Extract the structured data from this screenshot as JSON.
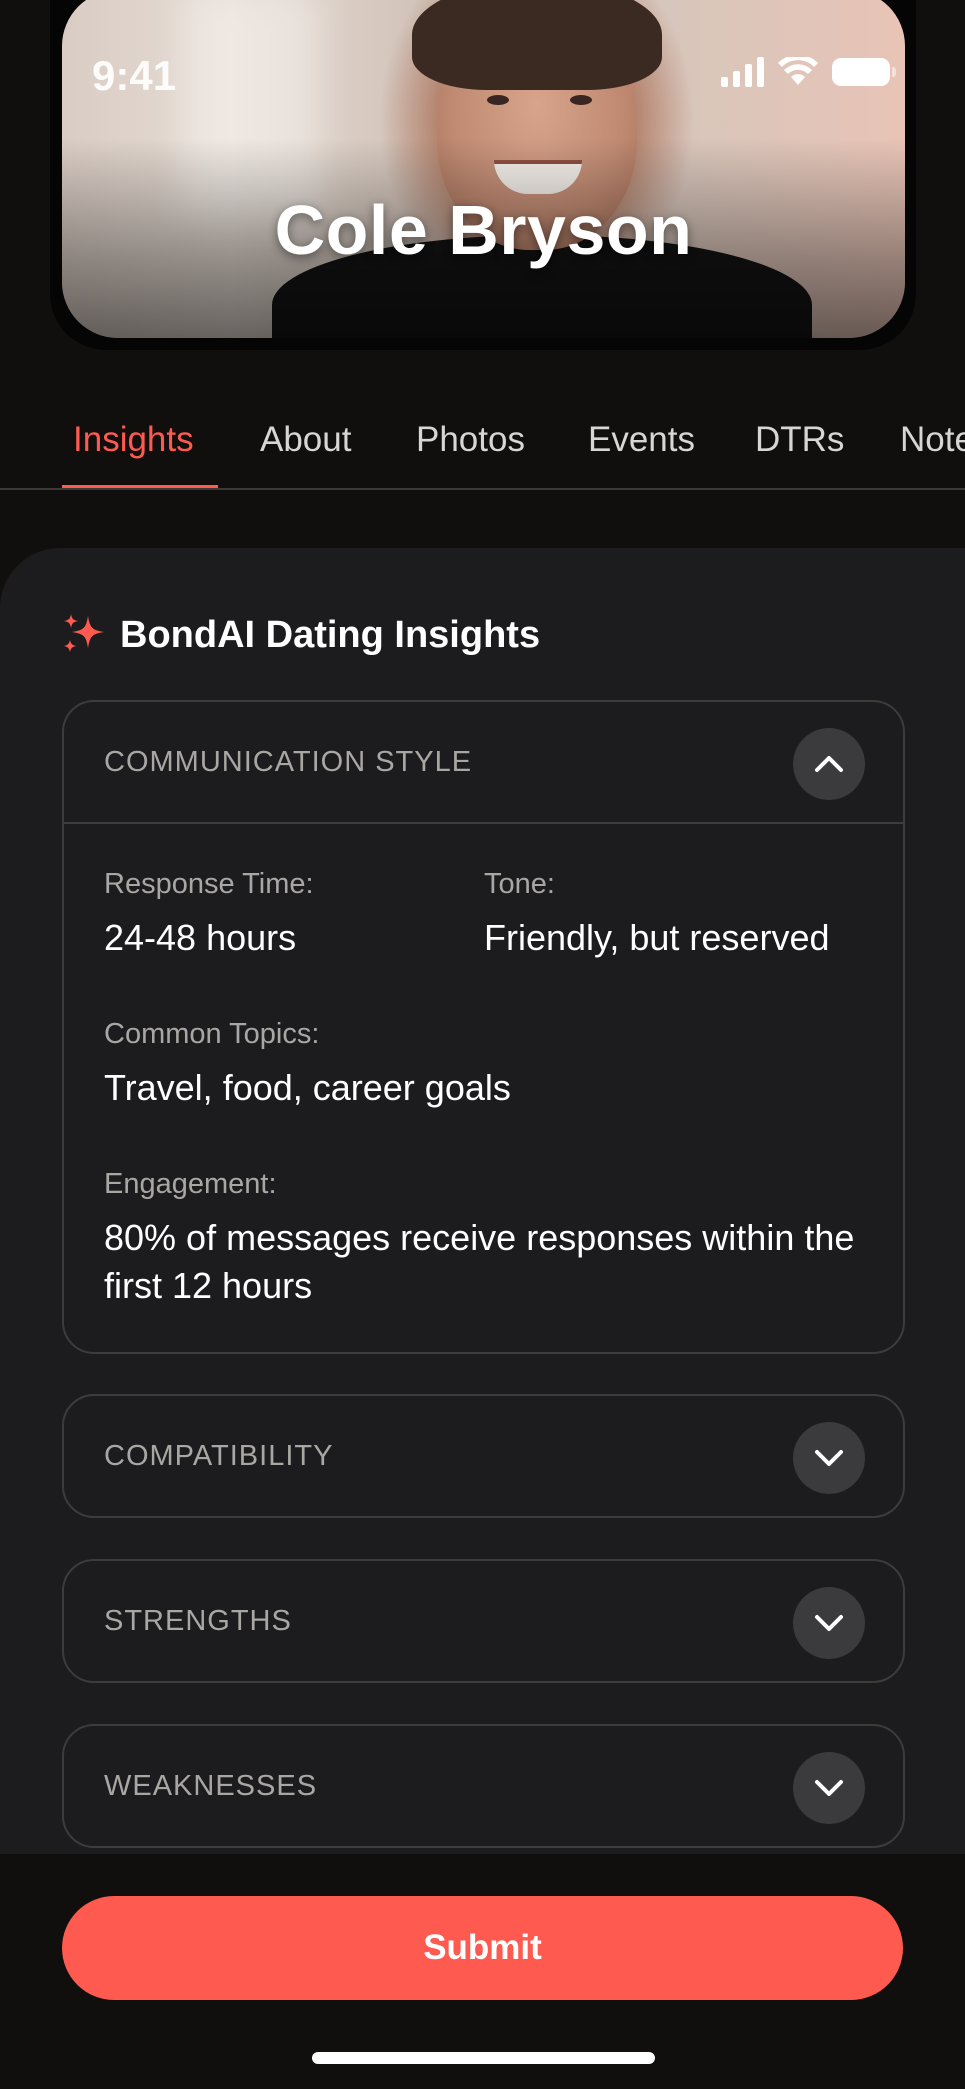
{
  "status_bar": {
    "time": "9:41"
  },
  "profile": {
    "name": "Cole Bryson"
  },
  "tabs": [
    {
      "label": "Insights",
      "active": true
    },
    {
      "label": "About"
    },
    {
      "label": "Photos"
    },
    {
      "label": "Events"
    },
    {
      "label": "DTRs"
    },
    {
      "label": "Note"
    }
  ],
  "insights": {
    "title": "BondAI Dating Insights",
    "icon": "sparkles-icon",
    "accent_color": "#ff5a4f",
    "cards": [
      {
        "label": "COMMUNICATION STYLE",
        "expanded": true,
        "fields": [
          {
            "label": "Response Time:",
            "value": "24-48 hours"
          },
          {
            "label": "Tone:",
            "value": "Friendly, but reserved"
          },
          {
            "label": "Common Topics:",
            "value": "Travel, food, career goals"
          },
          {
            "label": "Engagement:",
            "value": "80% of messages receive responses within the first 12 hours"
          }
        ]
      },
      {
        "label": "COMPATIBILITY",
        "expanded": false
      },
      {
        "label": "STRENGTHS",
        "expanded": false
      },
      {
        "label": "WEAKNESSES",
        "expanded": false
      }
    ]
  },
  "actions": {
    "submit_label": "Submit"
  }
}
